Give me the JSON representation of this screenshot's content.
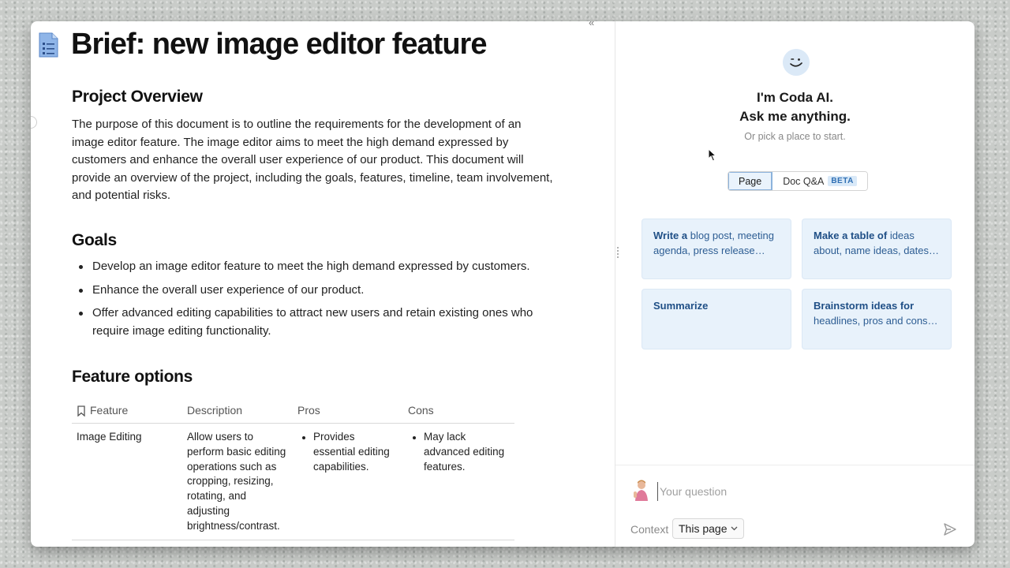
{
  "doc": {
    "title": "Brief: new image editor feature",
    "overview": {
      "heading": "Project Overview",
      "body": "The purpose of this document is to outline the requirements for the development of an image editor feature. The image editor aims to meet the high demand expressed by customers and enhance the overall user experience of our product. This document will provide an overview of the project, including the goals, features, timeline, team involvement, and potential risks."
    },
    "goals": {
      "heading": "Goals",
      "items": [
        "Develop an image editor feature to meet the high demand expressed by customers.",
        "Enhance the overall user experience of our product.",
        "Offer advanced editing capabilities to attract new users and retain existing ones who require image editing functionality."
      ]
    },
    "features": {
      "heading": "Feature options",
      "columns": [
        "Feature",
        "Description",
        "Pros",
        "Cons"
      ],
      "rows": [
        {
          "feature": "Image Editing",
          "description": "Allow users to perform basic editing operations such as cropping, resizing, rotating, and adjusting brightness/contrast.",
          "pros": [
            "Provides essential editing capabilities."
          ],
          "cons": [
            "May lack advanced editing features."
          ]
        }
      ]
    },
    "collapse_glyph": "«"
  },
  "ai": {
    "title_line1": "I'm Coda AI.",
    "title_line2": "Ask me anything.",
    "subtitle": "Or pick a place to start.",
    "tabs": [
      {
        "label": "Page",
        "active": true
      },
      {
        "label": "Doc Q&A",
        "badge": "BETA",
        "active": false
      }
    ],
    "suggestions": [
      {
        "bold": "Write a",
        "rest": " blog post, meeting agenda, press release…"
      },
      {
        "bold": "Make a table of",
        "rest": " ideas about, name ideas, dates…"
      },
      {
        "bold": "Summarize",
        "rest": ""
      },
      {
        "bold": "Brainstorm ideas for",
        "rest": " headlines, pros and cons…"
      }
    ],
    "input_placeholder": "Your question",
    "context_label": "Context",
    "context_value": "This page"
  },
  "colors": {
    "accent": "#2f6fb3",
    "card_bg": "#e8f2fb",
    "card_text": "#2d5d93"
  }
}
